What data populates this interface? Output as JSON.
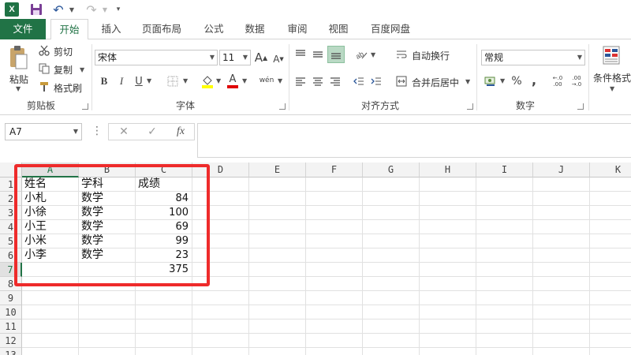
{
  "window": {
    "app_icon_label": "X",
    "quick_access": [
      "save-icon",
      "undo-icon",
      "redo-icon"
    ]
  },
  "tabs": [
    {
      "label": "文件"
    },
    {
      "label": "开始"
    },
    {
      "label": "插入"
    },
    {
      "label": "页面布局"
    },
    {
      "label": "公式"
    },
    {
      "label": "数据"
    },
    {
      "label": "审阅"
    },
    {
      "label": "视图"
    },
    {
      "label": "百度网盘"
    }
  ],
  "ribbon": {
    "clipboard": {
      "paste_label": "粘贴",
      "cut_label": "剪切",
      "copy_label": "复制",
      "format_painter_label": "格式刷",
      "group_label": "剪贴板"
    },
    "font": {
      "font_name": "宋体",
      "font_size": "11",
      "increase_label": "A",
      "decrease_label": "A",
      "bold_label": "B",
      "italic_label": "I",
      "underline_label": "U",
      "font_color_label": "A",
      "phonetic_label": "wén",
      "group_label": "字体",
      "highlight_color": "#ffff00",
      "font_color": "#e00000"
    },
    "alignment": {
      "wrap_text_label": "自动换行",
      "merge_center_label": "合并后居中",
      "group_label": "对齐方式"
    },
    "number": {
      "format_value": "常规",
      "percent_label": "%",
      "comma_label": ",",
      "increase_decimal_label": "←.0 .00",
      "decrease_decimal_label": ".00 →.0",
      "group_label": "数字"
    },
    "styles": {
      "conditional_format_label": "条件格式"
    }
  },
  "formula_bar": {
    "name_box": "A7",
    "cancel_label": "✕",
    "enter_label": "✓",
    "function_label": "fx",
    "formula": ""
  },
  "sheet": {
    "columns": [
      "A",
      "B",
      "C",
      "D",
      "E",
      "F",
      "G",
      "H",
      "I",
      "J",
      "K"
    ],
    "rows": [
      "1",
      "2",
      "3",
      "4",
      "5",
      "6",
      "7",
      "8",
      "9",
      "10",
      "11",
      "12",
      "13"
    ],
    "selected_column": "A",
    "selected_row": "7",
    "cells": {
      "A1": "姓名",
      "B1": "学科",
      "C1": "成绩",
      "A2": "小札",
      "B2": "数学",
      "C2": "84",
      "A3": "小徐",
      "B3": "数学",
      "C3": "100",
      "A4": "小王",
      "B4": "数学",
      "C4": "69",
      "A5": "小米",
      "B5": "数学",
      "C5": "99",
      "A6": "小李",
      "B6": "数学",
      "C6": "23",
      "C7": "375"
    },
    "annotation_color": "#ee2b2b"
  }
}
